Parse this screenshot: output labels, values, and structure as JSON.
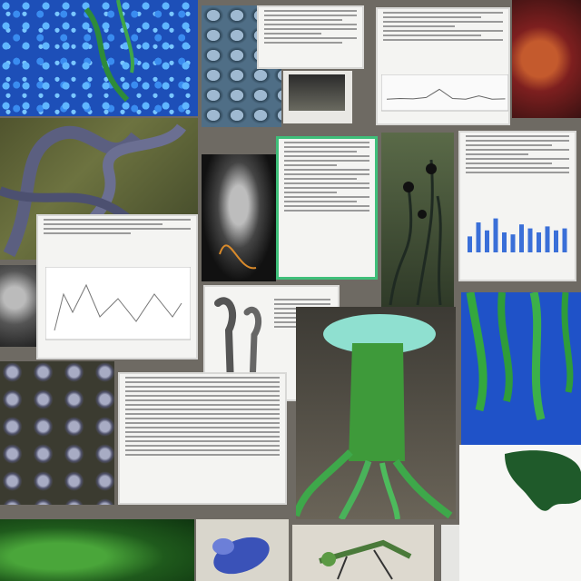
{
  "image": {
    "description_type": "collage",
    "colors": {
      "background": "#6e6a63",
      "cell_blue": "#1d4fb8",
      "plant_green": "#3fbf7a",
      "doc_paper": "#f4f4f2",
      "chart_bar": "#3a6fd8"
    },
    "chart_bars": [
      0.4,
      0.75,
      0.55,
      0.85,
      0.5,
      0.45,
      0.7,
      0.6,
      0.5,
      0.65,
      0.55,
      0.6
    ],
    "line_profile": [
      0.3,
      0.32,
      0.31,
      0.35,
      0.6,
      0.32,
      0.3,
      0.4,
      0.3,
      0.31
    ]
  }
}
